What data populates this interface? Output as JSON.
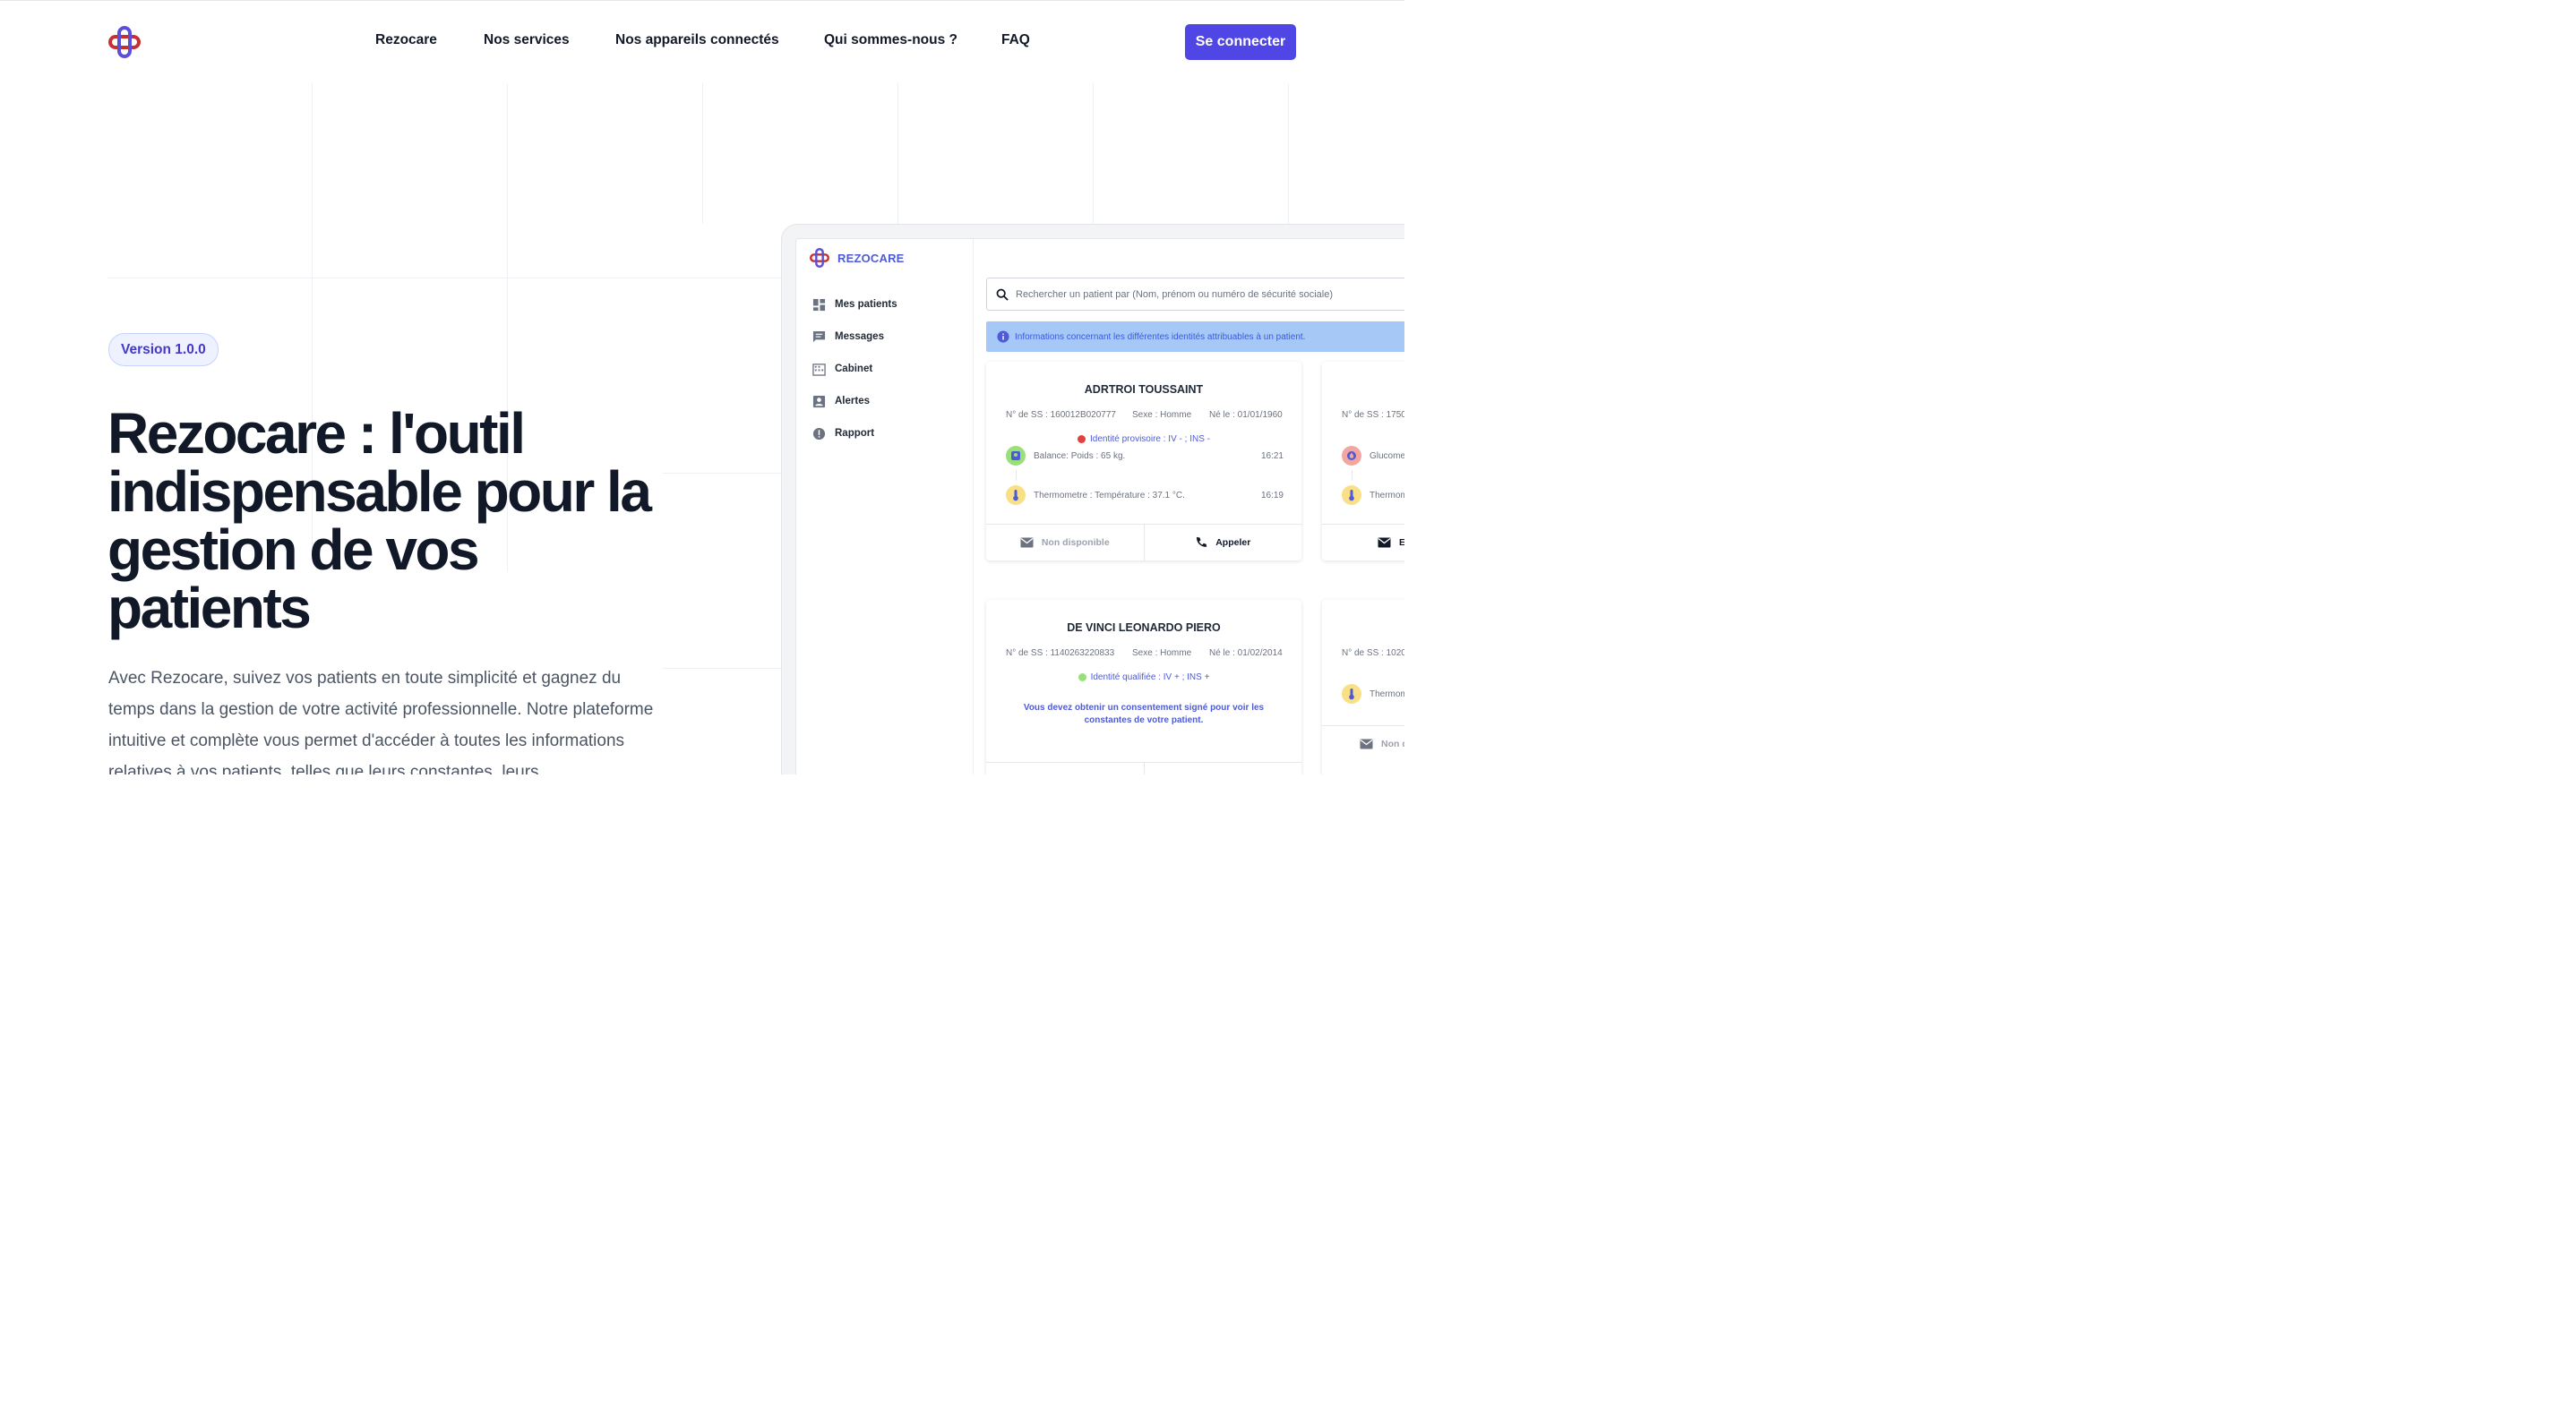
{
  "header": {
    "logo": "rezocare-logo",
    "nav": [
      "Rezocare",
      "Nos services",
      "Nos appareils connectés",
      "Qui sommes-nous ?",
      "FAQ"
    ],
    "cta_label": "Se connecter"
  },
  "hero": {
    "badge": "Version 1.0.0",
    "title": "Rezocare : l'outil indispensable pour la gestion de vos patients",
    "description": "Avec Rezocare, suivez vos patients en toute simplicité et gagnez du temps dans la gestion de votre activité professionnelle. Notre plateforme intuitive et complète vous permet d'accéder à toutes les informations relatives à vos patients, telles que leurs constantes, leurs"
  },
  "app": {
    "brand": "REZOCARE",
    "sidebar": [
      {
        "label": "Mes patients",
        "icon": "dashboard-icon"
      },
      {
        "label": "Messages",
        "icon": "message-icon"
      },
      {
        "label": "Cabinet",
        "icon": "building-icon"
      },
      {
        "label": "Alertes",
        "icon": "contact-icon"
      },
      {
        "label": "Rapport",
        "icon": "alert-circle-icon"
      }
    ],
    "search_placeholder": "Rechercher un patient par (Nom, prénom ou numéro de sécurité sociale)",
    "info_banner": "Informations concernant les différentes identités attribuables à un patient.",
    "cards": [
      {
        "name": "ADRTROI TOUSSAINT",
        "ss": "N° de SS : 160012B020777",
        "sexe": "Sexe : Homme",
        "born": "Né le : 01/01/1960",
        "identity": "Identité provisoire : IV - ; INS -",
        "identity_color": "#e53e3e",
        "measures": [
          {
            "label": "Balance: Poids : 65 kg.",
            "time": "16:21",
            "icon": "scale-icon"
          },
          {
            "label": "Thermometre : Température : 37.1 °C.",
            "time": "16:19",
            "icon": "thermometer-icon"
          }
        ],
        "action_left": "Non disponible",
        "action_right": "Appeler"
      },
      {
        "ss": "N° de SS : 1750",
        "measures": [
          {
            "label": "Glucome",
            "icon": "glucose-icon"
          },
          {
            "label": "Thermom",
            "icon": "thermometer-icon"
          }
        ],
        "action_left": "E"
      },
      {
        "name": "DE VINCI LEONARDO PIERO",
        "ss": "N° de SS : 1140263220833",
        "sexe": "Sexe : Homme",
        "born": "Né le : 01/02/2014",
        "identity": "Identité qualifiée : IV + ; INS +",
        "identity_color": "#9ae07a",
        "consent": "Vous devez obtenir un consentement signé pour voir les constantes de votre patient."
      },
      {
        "ss": "N° de SS : 1020",
        "measures": [
          {
            "label": "Thermom",
            "icon": "thermometer-icon"
          }
        ],
        "action_left": "Non d"
      }
    ]
  }
}
